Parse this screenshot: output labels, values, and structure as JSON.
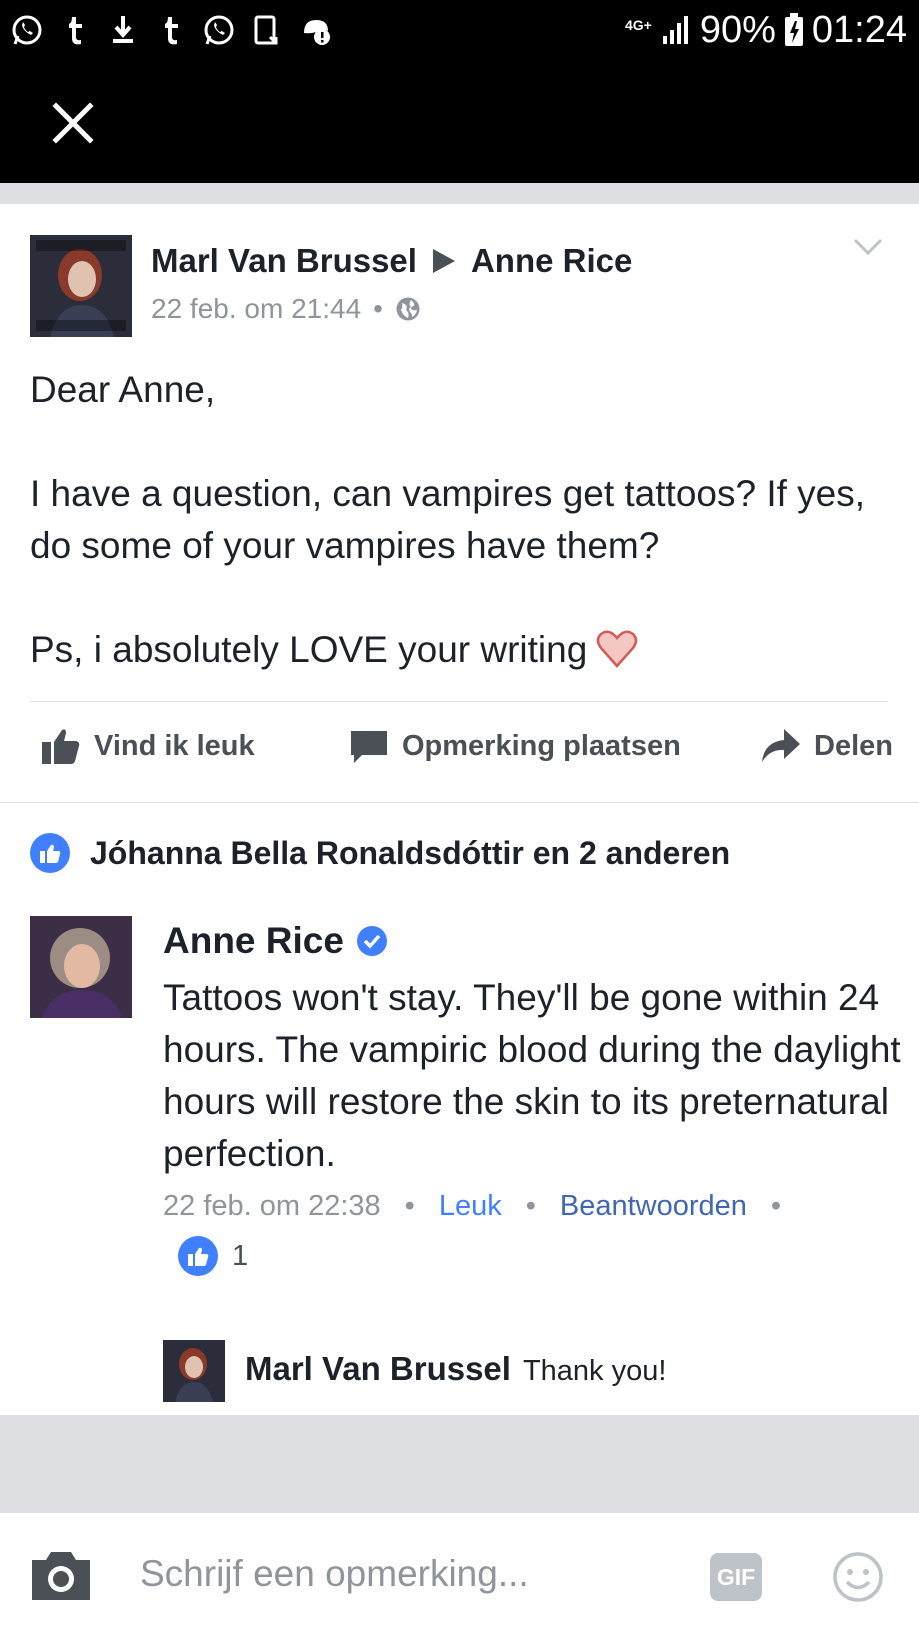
{
  "status_bar": {
    "network_type": "4G+",
    "battery_percent": "90%",
    "time": "01:24",
    "icons": [
      "whatsapp-icon",
      "tumblr-icon",
      "download-icon",
      "tumblr-icon",
      "whatsapp-icon",
      "screenshot-icon",
      "alert-icon"
    ]
  },
  "post": {
    "author": "Marl Van Brussel",
    "recipient": "Anne Rice",
    "timestamp": "22 feb. om 21:44",
    "separator": "•",
    "body": {
      "greeting": "Dear Anne,",
      "question": "I have a question, can vampires get tattoos? If yes, do some of your vampires have them?",
      "ps": "Ps, i absolutely LOVE your writing"
    },
    "actions": {
      "like": "Vind ik leuk",
      "comment": "Opmerking plaatsen",
      "share": "Delen"
    },
    "reactions_summary": "Jóhanna Bella Ronaldsdóttir en 2 anderen"
  },
  "comment": {
    "author": "Anne Rice",
    "verified": true,
    "text": "Tattoos won't stay. They'll be gone within 24 hours.  The vampiric blood during the daylight hours will restore the skin to its preternatural perfection.",
    "timestamp": "22 feb. om 22:38",
    "like_link": "Leuk",
    "reply_link": "Beantwoorden",
    "separator": "•",
    "like_count": "1"
  },
  "reply": {
    "author": "Marl Van Brussel",
    "text": "Thank you!"
  },
  "composer": {
    "placeholder": "Schrijf een opmerking...",
    "gif_label": "GIF"
  },
  "colors": {
    "fb_blue": "#4267b2",
    "like_blue": "#4080ff",
    "meta_grey": "#90949c",
    "divider": "#dddfe2"
  }
}
